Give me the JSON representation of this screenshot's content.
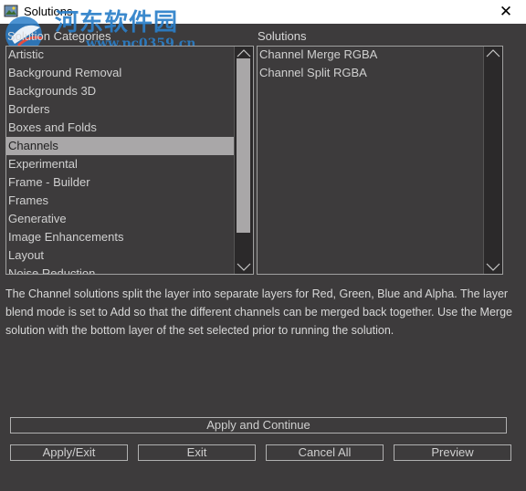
{
  "window": {
    "title": "Solutions",
    "close_glyph": "✕"
  },
  "watermark": {
    "text": "河东软件园",
    "url": "www.pc0359.cn"
  },
  "categories": {
    "label": "Solution Categories",
    "items": [
      "Artistic",
      "Background Removal",
      "Backgrounds 3D",
      "Borders",
      "Boxes and Folds",
      "Channels",
      "Experimental",
      "Frame - Builder",
      "Frames",
      "Generative",
      "Image Enhancements",
      "Layout",
      "Noise Reduction"
    ],
    "selected": "Channels"
  },
  "solutions": {
    "label": "Solutions",
    "items": [
      "Channel Merge RGBA",
      "Channel Split RGBA"
    ]
  },
  "description": "The Channel solutions split the layer into separate layers for Red, Green, Blue and Alpha. The layer blend mode is set to Add so that the different channels can be merged back together. Use the Merge solution with the bottom layer of the set selected prior to running the solution.",
  "buttons": {
    "apply_continue": "Apply and Continue",
    "apply_exit": "Apply/Exit",
    "exit": "Exit",
    "cancel_all": "Cancel All",
    "preview": "Preview"
  },
  "colors": {
    "background": "#3d3b3c",
    "selection": "#a9a7a8",
    "watermark": "#2b7fc9"
  }
}
